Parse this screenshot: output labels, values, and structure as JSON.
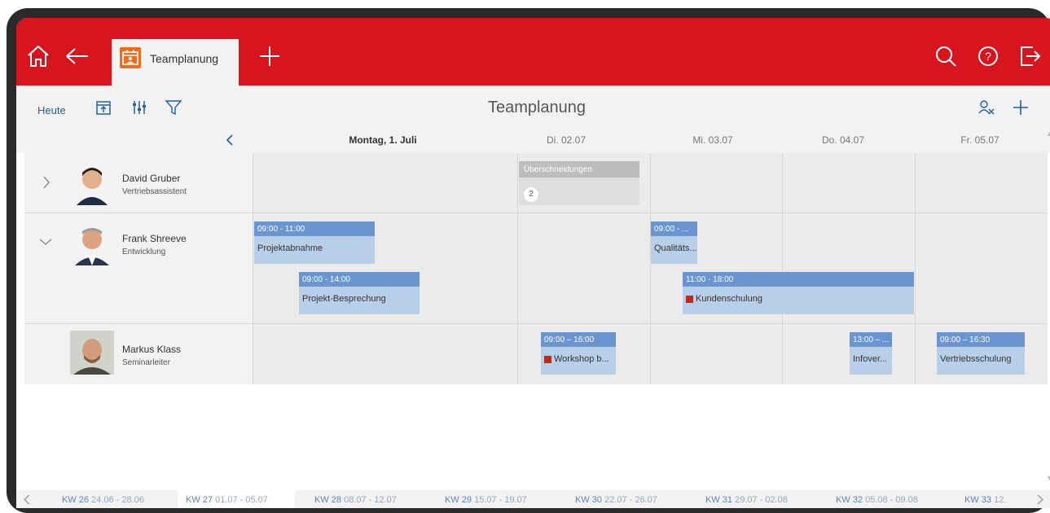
{
  "header": {
    "tab_label": "Teamplanung",
    "icons": [
      "home-icon",
      "back-arrow-icon",
      "calendar-person-icon",
      "plus-icon",
      "search-icon",
      "help-icon",
      "logout-icon"
    ]
  },
  "toolbar": {
    "today_label": "Heute",
    "title": "Teamplanung",
    "icons": [
      "calendar-export-icon",
      "columns-settings-icon",
      "filter-icon",
      "person-search-icon",
      "add-icon"
    ]
  },
  "days": [
    {
      "label": "Montag, 1. Juli",
      "bold": true
    },
    {
      "label": "Di. 02.07",
      "bold": false
    },
    {
      "label": "Mi. 03.07",
      "bold": false
    },
    {
      "label": "Do. 04.07",
      "bold": false
    },
    {
      "label": "Fr. 05.07",
      "bold": false
    }
  ],
  "people": [
    {
      "name": "David Gruber",
      "role": "Vertriebsassistent",
      "expander": "chevron-right-icon"
    },
    {
      "name": "Frank Shreeve",
      "role": "Entwicklung",
      "expander": "chevron-down-icon"
    },
    {
      "name": "Markus Klass",
      "role": "Seminarleiter"
    }
  ],
  "overlap": {
    "label": "Überschneidungen",
    "count": "2"
  },
  "events": [
    {
      "time": "09:00 - 11:00",
      "name": "Projektabnahme"
    },
    {
      "time": "09:00 - 14:00",
      "name": "Projekt-Besprechung"
    },
    {
      "time": "09:00 - ...",
      "name": "Qualitäts..."
    },
    {
      "time": "11:00 - 18:00",
      "name": "Kundenschulung",
      "marker": true
    },
    {
      "time": "09:00 – 16:00",
      "name": "Workshop b...",
      "marker": true
    },
    {
      "time": "13:00 – ...",
      "name": "Infover..."
    },
    {
      "time": "09:00 – 16:30",
      "name": "Vertriebsschulung"
    }
  ],
  "weeks": [
    {
      "kw": "KW 26",
      "dates": "24.06 - 28.06"
    },
    {
      "kw": "KW 27",
      "dates": "01.07 - 05.07",
      "active": true
    },
    {
      "kw": "KW 28",
      "dates": "08.07 - 12.07"
    },
    {
      "kw": "KW 29",
      "dates": "15.07 - 19.07"
    },
    {
      "kw": "KW 30",
      "dates": "22.07 - 26.07"
    },
    {
      "kw": "KW 31",
      "dates": "29.07 - 02.08"
    },
    {
      "kw": "KW 32",
      "dates": "05.08 - 09.08"
    },
    {
      "kw": "KW 33",
      "dates": "12."
    }
  ],
  "colors": {
    "brand_red": "#d8141e",
    "event_header": "#6b95cf",
    "event_body": "#b8cfea",
    "link_blue": "#1f5fa8"
  }
}
